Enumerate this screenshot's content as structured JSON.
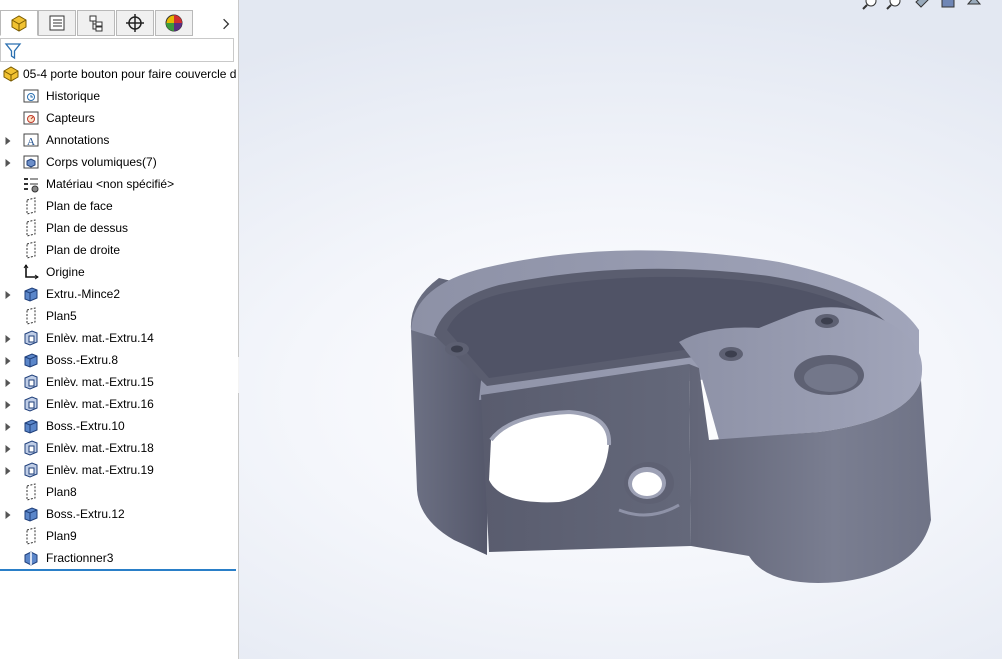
{
  "tabs": [
    {
      "icon": "feature-manager-icon",
      "active": true
    },
    {
      "icon": "property-manager-icon",
      "active": false
    },
    {
      "icon": "configuration-manager-icon",
      "active": false
    },
    {
      "icon": "dimxpert-manager-icon",
      "active": false
    },
    {
      "icon": "display-manager-icon",
      "active": false
    }
  ],
  "tree": {
    "root_label": "05-4 porte bouton pour faire couvercle d",
    "items": [
      {
        "label": "Historique",
        "icon": "history-icon",
        "expandable": false
      },
      {
        "label": "Capteurs",
        "icon": "sensors-icon",
        "expandable": false
      },
      {
        "label": "Annotations",
        "icon": "annotations-icon",
        "expandable": true
      },
      {
        "label": "Corps volumiques(7)",
        "icon": "solid-bodies-icon",
        "expandable": true
      },
      {
        "label": "Matériau <non spécifié>",
        "icon": "material-icon",
        "expandable": false
      },
      {
        "label": "Plan de face",
        "icon": "plane-icon",
        "expandable": false
      },
      {
        "label": "Plan de dessus",
        "icon": "plane-icon",
        "expandable": false
      },
      {
        "label": "Plan de droite",
        "icon": "plane-icon",
        "expandable": false
      },
      {
        "label": "Origine",
        "icon": "origin-icon",
        "expandable": false
      },
      {
        "label": "Extru.-Mince2",
        "icon": "boss-extrude-icon",
        "expandable": true
      },
      {
        "label": "Plan5",
        "icon": "plane-icon",
        "expandable": false
      },
      {
        "label": "Enlèv. mat.-Extru.14",
        "icon": "cut-extrude-icon",
        "expandable": true
      },
      {
        "label": "Boss.-Extru.8",
        "icon": "boss-extrude-icon",
        "expandable": true
      },
      {
        "label": "Enlèv. mat.-Extru.15",
        "icon": "cut-extrude-icon",
        "expandable": true
      },
      {
        "label": "Enlèv. mat.-Extru.16",
        "icon": "cut-extrude-icon",
        "expandable": true
      },
      {
        "label": "Boss.-Extru.10",
        "icon": "boss-extrude-icon",
        "expandable": true
      },
      {
        "label": "Enlèv. mat.-Extru.18",
        "icon": "cut-extrude-icon",
        "expandable": true
      },
      {
        "label": "Enlèv. mat.-Extru.19",
        "icon": "cut-extrude-icon",
        "expandable": true
      },
      {
        "label": "Plan8",
        "icon": "plane-icon",
        "expandable": false
      },
      {
        "label": "Boss.-Extru.12",
        "icon": "boss-extrude-icon",
        "expandable": true
      },
      {
        "label": "Plan9",
        "icon": "plane-icon",
        "expandable": false
      },
      {
        "label": "Fractionner3",
        "icon": "split-icon",
        "expandable": false
      }
    ]
  },
  "colors": {
    "rollback_bar": "#2a7fc8",
    "model_top": "#9a9eb4",
    "model_front": "#5c5f72",
    "model_side": "#737789"
  }
}
